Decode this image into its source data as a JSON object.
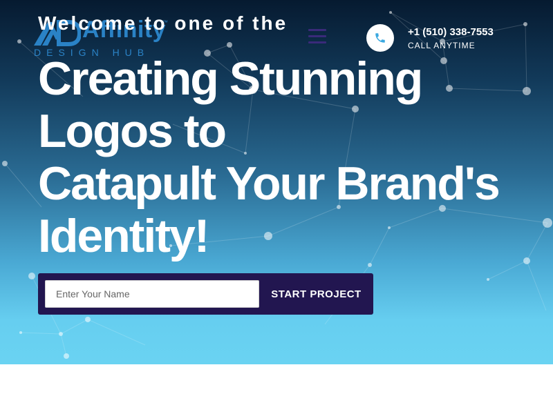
{
  "header": {
    "welcome_text": "Welcome to one of the",
    "logo": {
      "word": "Affinity",
      "tm": "™",
      "tagline": "DESIGN HUB"
    },
    "menu_icon": "hamburger-menu-icon",
    "contact": {
      "icon": "phone-icon",
      "phone": "+1 (510) 338-7553",
      "caption": "CALL ANYTIME"
    }
  },
  "hero": {
    "headline_lines": [
      "Creating Stunning",
      "Logos to",
      "Catapult Your Brand's",
      "Identity!"
    ],
    "form": {
      "name_placeholder": "Enter Your Name",
      "name_value": "",
      "submit_label": "START PROJECT"
    }
  },
  "colors": {
    "hero_top": "#061a30",
    "hero_bottom": "#6ad3f2",
    "cta_background": "#221650",
    "logo_blue": "#2f8fd8",
    "phone_icon_color": "#3aa8e0"
  }
}
